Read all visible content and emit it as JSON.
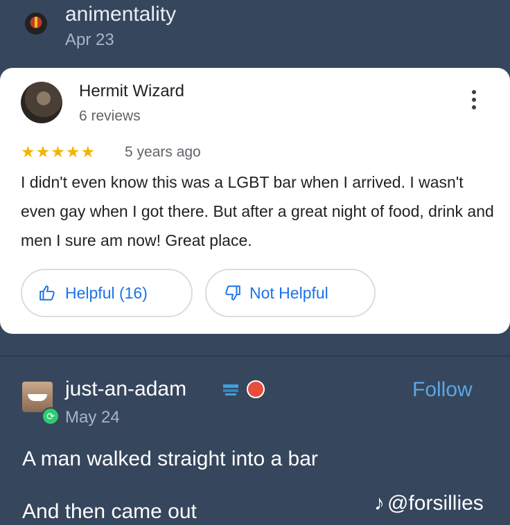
{
  "post1": {
    "username": "animentality",
    "date": "Apr 23"
  },
  "review": {
    "reviewer_name": "Hermit Wizard",
    "reviewer_count": "6 reviews",
    "stars": "★★★★★",
    "rating": 5,
    "time_ago": "5 years ago",
    "text": "I didn't even know this was a LGBT bar when I arrived. I wasn't even gay when I got there. But after a great night of food, drink and men I sure am now! Great place.",
    "helpful_label": "Helpful (16)",
    "not_helpful_label": "Not Helpful",
    "accent_color": "#1a73e8",
    "star_color": "#f4b400"
  },
  "post2": {
    "username": "just-an-adam",
    "date": "May 24",
    "follow_label": "Follow",
    "line1": "A man walked straight into a bar",
    "line2": "And then came out"
  },
  "watermark": {
    "handle": "@forsillies",
    "icon": "♪"
  }
}
